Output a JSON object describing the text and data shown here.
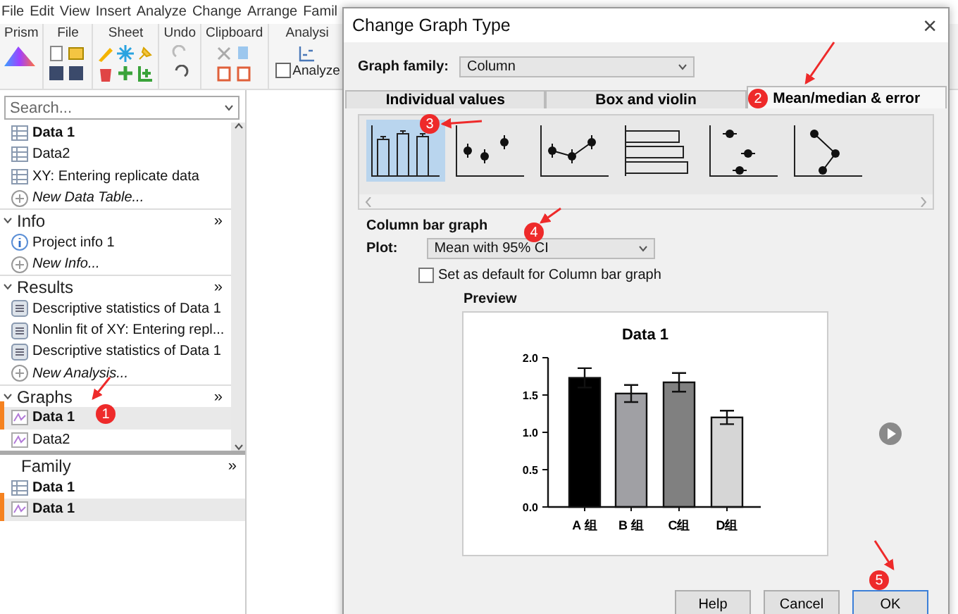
{
  "menu": [
    "File",
    "Edit",
    "View",
    "Insert",
    "Analyze",
    "Change",
    "Arrange",
    "Famil"
  ],
  "ribbon": {
    "groups": [
      {
        "label": "Prism",
        "kind": "prism"
      },
      {
        "label": "File",
        "kind": "file"
      },
      {
        "label": "Sheet",
        "kind": "sheet"
      },
      {
        "label": "Undo",
        "kind": "undo"
      },
      {
        "label": "Clipboard",
        "kind": "clipboard"
      },
      {
        "label": "Analysi",
        "kind": "analysis",
        "button": "Analyze"
      }
    ]
  },
  "navigator": {
    "search": {
      "placeholder": "Search..."
    },
    "sections": [
      {
        "items": [
          {
            "label": "Data 1",
            "kind": "table",
            "emphasized": true,
            "selected": false
          },
          {
            "label": "Data2",
            "kind": "table",
            "emphasized": false,
            "selected": false
          },
          {
            "label": "XY: Entering replicate data",
            "kind": "table",
            "emphasized": false,
            "selected": false
          },
          {
            "label": "New Data Table...",
            "kind": "new",
            "emphasized": false,
            "selected": false
          }
        ]
      },
      {
        "title": "Info",
        "more": "»",
        "expanded": true,
        "items": [
          {
            "label": "Project info 1",
            "kind": "info",
            "emphasized": false,
            "selected": false
          },
          {
            "label": "New Info...",
            "kind": "new",
            "emphasized": false,
            "selected": false
          }
        ]
      },
      {
        "title": "Results",
        "more": "»",
        "expanded": true,
        "items": [
          {
            "label": "Descriptive statistics of Data 1",
            "kind": "result",
            "emphasized": false,
            "selected": false
          },
          {
            "label": "Nonlin fit of XY: Entering repl...",
            "kind": "result",
            "emphasized": false,
            "selected": false
          },
          {
            "label": "Descriptive statistics of Data 1",
            "kind": "result",
            "emphasized": false,
            "selected": false
          },
          {
            "label": "New Analysis...",
            "kind": "new",
            "emphasized": false,
            "selected": false
          }
        ]
      },
      {
        "title": "Graphs",
        "more": "»",
        "expanded": true,
        "items": [
          {
            "label": "Data 1",
            "kind": "graph",
            "emphasized": true,
            "selected": true
          },
          {
            "label": "Data2",
            "kind": "graph",
            "emphasized": false,
            "selected": false
          }
        ]
      }
    ]
  },
  "family": {
    "title": "Family",
    "more": "»",
    "items": [
      {
        "label": "Data 1",
        "kind": "table",
        "emphasized": true,
        "selected": false
      },
      {
        "label": "Data 1",
        "kind": "graph",
        "emphasized": true,
        "selected": true
      }
    ]
  },
  "dialog": {
    "title": "Change Graph Type",
    "close": "×",
    "graph_family": {
      "label": "Graph family:",
      "value": "Column"
    },
    "tabs": [
      {
        "label": "Individual values",
        "selected": false
      },
      {
        "label": "Box and violin",
        "selected": false
      },
      {
        "label": "Mean/median & error",
        "selected": true
      }
    ],
    "gallery": [
      {
        "kind": "columns",
        "selected": true
      },
      {
        "kind": "points",
        "selected": false
      },
      {
        "kind": "line",
        "selected": false
      },
      {
        "kind": "hbars",
        "selected": false
      },
      {
        "kind": "dots",
        "selected": false
      },
      {
        "kind": "connected",
        "selected": false
      }
    ],
    "section_title": "Column bar graph",
    "plot": {
      "label": "Plot:",
      "value": "Mean with 95% CI"
    },
    "default_checkbox": {
      "label": "Set as default for Column bar graph",
      "checked": false
    },
    "preview": {
      "label": "Preview",
      "chart_data": {
        "type": "bar",
        "title": "Data 1",
        "categories": [
          "A 组",
          "B 组",
          "C组",
          "D组"
        ],
        "values": [
          1.73,
          1.52,
          1.67,
          1.2
        ],
        "ylim": [
          0,
          2
        ],
        "yticks": [
          {
            "value": 0,
            "label": "0.0"
          },
          {
            "value": 0.5,
            "label": "0.5"
          },
          {
            "value": 1,
            "label": "1.0"
          },
          {
            "value": 1.5,
            "label": "1.5"
          },
          {
            "value": 2,
            "label": "2.0"
          }
        ]
      }
    },
    "buttons": [
      {
        "label": "Help",
        "default": false
      },
      {
        "label": "Cancel",
        "default": false
      },
      {
        "label": "OK",
        "default": true
      }
    ]
  },
  "annotations": [
    {
      "label": "1"
    },
    {
      "label": "2"
    },
    {
      "label": "3"
    },
    {
      "label": "4"
    },
    {
      "label": "5"
    }
  ]
}
